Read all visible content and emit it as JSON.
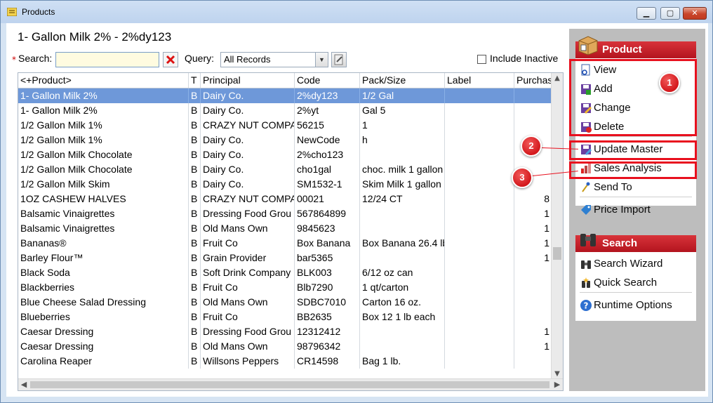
{
  "window": {
    "title": "Products"
  },
  "record_title": "1- Gallon Milk 2% - 2%dy123",
  "search": {
    "label": "Search:",
    "value": "",
    "required_mark": "*"
  },
  "query": {
    "label": "Query:",
    "selected": "All Records"
  },
  "include_inactive": {
    "label": "Include Inactive",
    "checked": false
  },
  "grid": {
    "columns": [
      "<+Product>",
      "T",
      "Principal",
      "Code",
      "Pack/Size",
      "Label",
      "Purchas"
    ],
    "rows": [
      [
        "1- Gallon Milk 2%",
        "B",
        "Dairy Co.",
        "2%dy123",
        "1/2 Gal",
        "",
        ""
      ],
      [
        "1- Gallon Milk 2%",
        "B",
        "Dairy Co.",
        "2%yt",
        "Gal 5",
        "",
        ""
      ],
      [
        "1/2 Gallon Milk 1%",
        "B",
        "CRAZY NUT COMPA",
        "56215",
        "1",
        "",
        ""
      ],
      [
        "1/2 Gallon Milk 1%",
        "B",
        "Dairy Co.",
        "NewCode",
        "h",
        "",
        ""
      ],
      [
        "1/2 Gallon Milk Chocolate",
        "B",
        "Dairy Co.",
        "2%cho123",
        "",
        "",
        ""
      ],
      [
        "1/2 Gallon Milk Chocolate",
        "B",
        "Dairy Co.",
        "cho1gal",
        "choc. milk 1 gallon",
        "",
        ""
      ],
      [
        "1/2 Gallon Milk Skim",
        "B",
        "Dairy Co.",
        "SM1532-1",
        "Skim Milk 1 gallon",
        "",
        ""
      ],
      [
        "1OZ CASHEW HALVES",
        "B",
        "CRAZY NUT COMPA",
        "00021",
        "12/24 CT",
        "",
        "8"
      ],
      [
        "Balsamic Vinaigrettes",
        "B",
        "Dressing Food Grou",
        "567864899",
        "",
        "",
        "1"
      ],
      [
        "Balsamic Vinaigrettes",
        "B",
        "Old Mans Own",
        "9845623",
        "",
        "",
        "1"
      ],
      [
        "Bananas®",
        "B",
        "Fruit Co",
        "Box Banana",
        "Box Banana 26.4 lb",
        "",
        "1"
      ],
      [
        "Barley Flour™",
        "B",
        "Grain Provider",
        "bar5365",
        "",
        "",
        "1"
      ],
      [
        "Black Soda",
        "B",
        "Soft Drink Company",
        "BLK003",
        "6/12 oz can",
        "",
        ""
      ],
      [
        "Blackberries",
        "B",
        "Fruit Co",
        "Blb7290",
        "1 qt/carton",
        "",
        ""
      ],
      [
        "Blue Cheese Salad Dressing",
        "B",
        "Old Mans Own",
        "SDBC7010",
        "Carton  16 oz.",
        "",
        ""
      ],
      [
        "Blueberries",
        "B",
        "Fruit Co",
        "BB2635",
        "Box 12 1 lb each",
        "",
        ""
      ],
      [
        "Caesar Dressing",
        "B",
        "Dressing Food Grou",
        "12312412",
        "",
        "",
        "1"
      ],
      [
        "Caesar Dressing",
        "B",
        "Old Mans Own",
        "98796342",
        "",
        "",
        "1"
      ],
      [
        "Carolina Reaper",
        "B",
        "Willsons Peppers",
        "CR14598",
        "Bag  1 lb.",
        "",
        ""
      ]
    ],
    "selected_row": 0
  },
  "task_pane": {
    "product_group": {
      "title": "Product",
      "items": [
        {
          "label": "View",
          "icon": "view-document-icon"
        },
        {
          "label": "Add",
          "icon": "add-disk-icon"
        },
        {
          "label": "Change",
          "icon": "change-pencil-icon"
        },
        {
          "label": "Delete",
          "icon": "delete-disk-icon"
        },
        {
          "label": "Update Master",
          "icon": "update-master-icon"
        },
        {
          "label": "Sales Analysis",
          "icon": "sales-chart-icon"
        },
        {
          "label": "Send To",
          "icon": "send-to-icon"
        },
        {
          "label": "Price Import",
          "icon": "price-tag-icon"
        }
      ]
    },
    "search_group": {
      "title": "Search",
      "items": [
        {
          "label": "Search Wizard",
          "icon": "binoculars-icon"
        },
        {
          "label": "Quick Search",
          "icon": "quick-search-icon"
        },
        {
          "label": "Runtime Options",
          "icon": "help-circle-icon"
        }
      ]
    }
  },
  "annotations": {
    "badges": [
      "1",
      "2",
      "3"
    ],
    "color": "#e8101e"
  }
}
